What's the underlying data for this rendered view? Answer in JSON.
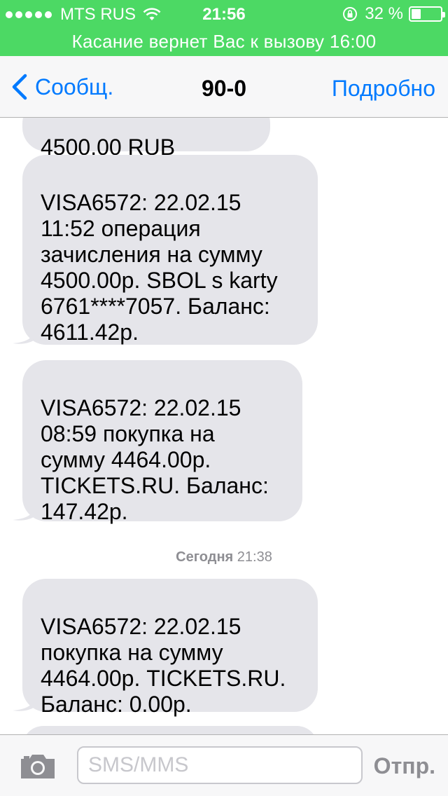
{
  "status_bar": {
    "carrier": "MTS RUS",
    "time": "21:56",
    "battery_percent": "32 %",
    "battery_level": 0.32,
    "signal_bars": 5
  },
  "call_banner": {
    "text": "Касание вернет Вас к вызову  16:00"
  },
  "nav": {
    "back_label": "Сообщ.",
    "title": "90-0",
    "details_label": "Подробно"
  },
  "messages": [
    {
      "text": "4500.00 RUB"
    },
    {
      "text": "VISA6572: 22.02.15\n11:52 операция\nзачисления на сумму\n4500.00р. SBOL s karty\n6761****7057. Баланс:\n4611.42р."
    },
    {
      "text": "VISA6572: 22.02.15\n08:59 покупка на\nсумму 4464.00р.\nTICKETS.RU. Баланс:\n147.42р."
    },
    {
      "text": "VISA6572: 22.02.15\nпокупка на сумму\n4464.00р. TICKETS.RU.\nБаланс: 0.00р."
    },
    {
      "text": ""
    }
  ],
  "timestamp": {
    "day": "Сегодня",
    "time": "21:38"
  },
  "input_bar": {
    "placeholder": "SMS/MMS",
    "value": "",
    "send_label": "Отпр."
  },
  "colors": {
    "status_green": "#4cd964",
    "ios_blue": "#007aff",
    "bubble_gray": "#e5e5ea"
  },
  "icons": [
    "signal-dots-icon",
    "wifi-icon",
    "rotation-lock-icon",
    "battery-icon",
    "chevron-left-icon",
    "camera-icon"
  ]
}
